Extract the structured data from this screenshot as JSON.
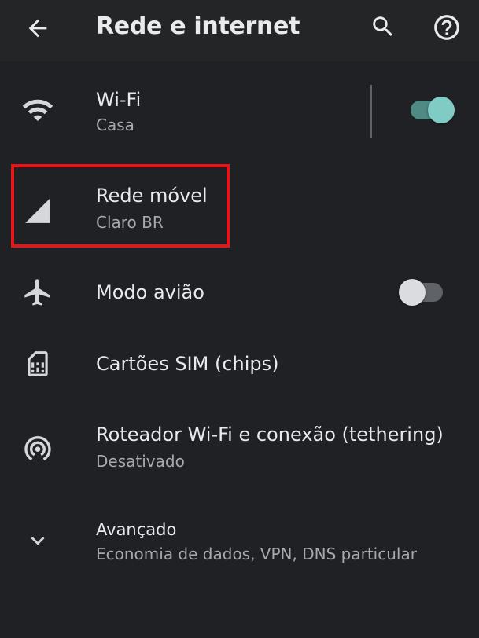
{
  "header": {
    "title": "Rede e internet",
    "back_icon": "arrow-back-icon",
    "search_icon": "search-icon",
    "help_icon": "help-icon"
  },
  "items": [
    {
      "id": "wifi",
      "title": "Wi-Fi",
      "subtitle": "Casa",
      "icon": "wifi-icon",
      "toggle": true
    },
    {
      "id": "mobile",
      "title": "Rede móvel",
      "subtitle": "Claro BR",
      "icon": "signal-icon",
      "highlighted": true
    },
    {
      "id": "airplane",
      "title": "Modo avião",
      "icon": "airplane-icon",
      "toggle": false
    },
    {
      "id": "sim",
      "title": "Cartões SIM (chips)",
      "icon": "sim-card-icon"
    },
    {
      "id": "hotspot",
      "title": "Roteador Wi-Fi e conexão (tethering)",
      "subtitle": "Desativado",
      "icon": "hotspot-icon"
    },
    {
      "id": "advanced",
      "title": "Avançado",
      "subtitle": "Economia de dados, VPN, DNS particular",
      "icon": "chevron-down-icon"
    }
  ],
  "colors": {
    "background": "#202124",
    "toolbar": "#232527",
    "text_primary": "#e8eaed",
    "text_secondary": "#a7a9ad",
    "accent": "#80cbc4",
    "highlight": "#e8141a"
  }
}
